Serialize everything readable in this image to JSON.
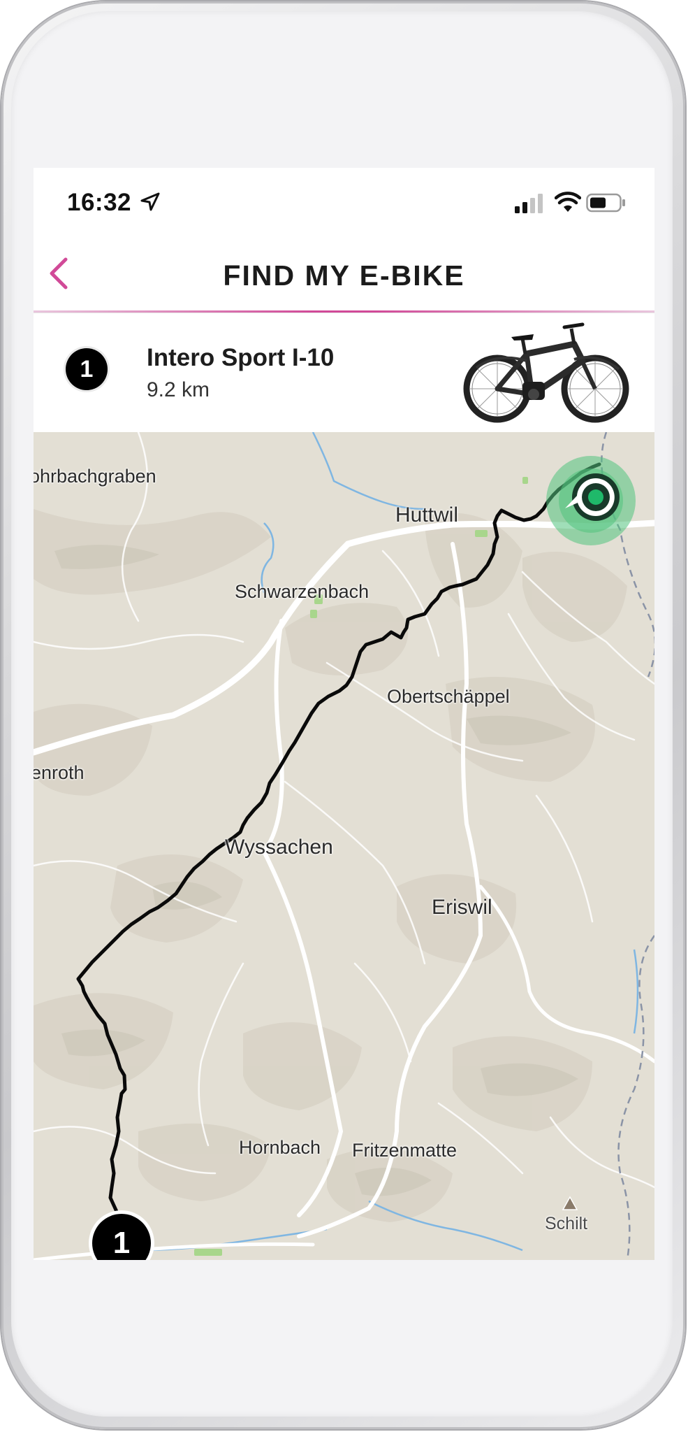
{
  "status_bar": {
    "time": "16:32",
    "location_icon": "location-arrow-icon",
    "signal_icon": "cellular-signal-icon",
    "wifi_icon": "wifi-icon",
    "battery_icon": "battery-icon"
  },
  "nav": {
    "title": "FIND MY E-BIKE",
    "back_icon": "chevron-left-icon",
    "accent_color": "#d14a98"
  },
  "bike": {
    "number": "1",
    "name": "Intero Sport I-10",
    "distance": "9.2 km",
    "image_icon": "e-bike-image"
  },
  "map": {
    "places": [
      {
        "name": "ohrbachgraben"
      },
      {
        "name": "Huttwil"
      },
      {
        "name": "Schwarzenbach"
      },
      {
        "name": "Obertschäppel"
      },
      {
        "name": "enroth"
      },
      {
        "name": "Wyssachen"
      },
      {
        "name": "Eriswil"
      },
      {
        "name": "Hornbach"
      },
      {
        "name": "Fritzenmatte"
      },
      {
        "name": "Schilt"
      }
    ],
    "route_color": "#000000",
    "current_position_color": "#1fb96a",
    "start_marker_label": "1"
  }
}
